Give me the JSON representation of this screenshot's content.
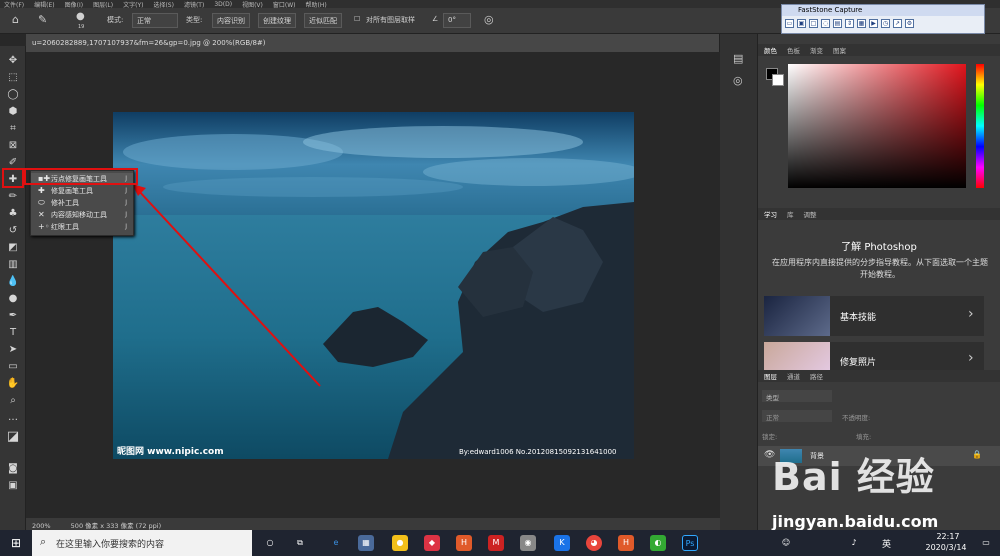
{
  "menubar": {
    "items": [
      "文件(F)",
      "编辑(E)",
      "图像(I)",
      "图层(L)",
      "文字(Y)",
      "选择(S)",
      "滤镜(T)",
      "3D(D)",
      "视图(V)",
      "窗口(W)",
      "帮助(H)"
    ]
  },
  "options": {
    "brush_size": "19",
    "mode_label": "模式:",
    "mode_value": "正常",
    "type_label": "类型:",
    "btn_content_aware": "内容识别",
    "btn_create_texture": "创建纹理",
    "btn_proximity": "近似匹配",
    "sample_all": "对所有图层取样",
    "angle": "0°"
  },
  "document": {
    "tab_title": "u=2060282889,1707107937&fm=26&gp=0.jpg @ 200%(RGB/8#)",
    "zoom": "200%",
    "info": "500 像素 x 333 像素 (72 ppi)",
    "photo_watermark_left": "昵图网 www.nipic.com",
    "photo_watermark_right": "By:edward1006  No.20120815092131641000"
  },
  "flyout": {
    "items": [
      {
        "icon": "spot-healing-icon",
        "label": "污点修复画笔工具",
        "key": "J"
      },
      {
        "icon": "healing-brush-icon",
        "label": "修复画笔工具",
        "key": "J"
      },
      {
        "icon": "patch-icon",
        "label": "修补工具",
        "key": "J"
      },
      {
        "icon": "content-aware-move-icon",
        "label": "内容感知移动工具",
        "key": "J"
      },
      {
        "icon": "red-eye-icon",
        "label": "红眼工具",
        "key": "J"
      }
    ]
  },
  "fastcapture": {
    "title": "FastStone Capture"
  },
  "color_panel": {
    "tabs": [
      "颜色",
      "色板",
      "渐变",
      "图案"
    ]
  },
  "learn_panel": {
    "tabs": [
      "学习",
      "库",
      "调整"
    ],
    "title": "了解 Photoshop",
    "desc": "在应用程序内直接提供的分步指导教程。从下面选取一个主题开始教程。",
    "cards": [
      "基本技能",
      "修复照片"
    ]
  },
  "layers_panel": {
    "tabs": [
      "图层",
      "通道",
      "路径"
    ],
    "kind": "类型",
    "blend": "正常",
    "opacity_label": "不透明度:",
    "lock_label": "锁定:",
    "fill_label": "填充:",
    "layer_name": "背景"
  },
  "taskbar": {
    "search_placeholder": "在这里输入你要搜索的内容",
    "ime": "英",
    "time": "22:17",
    "date": "2020/3/14"
  },
  "overlay": {
    "watermark": "Bai 经验",
    "url": "jingyan.baidu.com"
  },
  "colors": {
    "highlight": "#e01010",
    "ps_bg": "#282828",
    "panel": "#3b3b3b"
  }
}
